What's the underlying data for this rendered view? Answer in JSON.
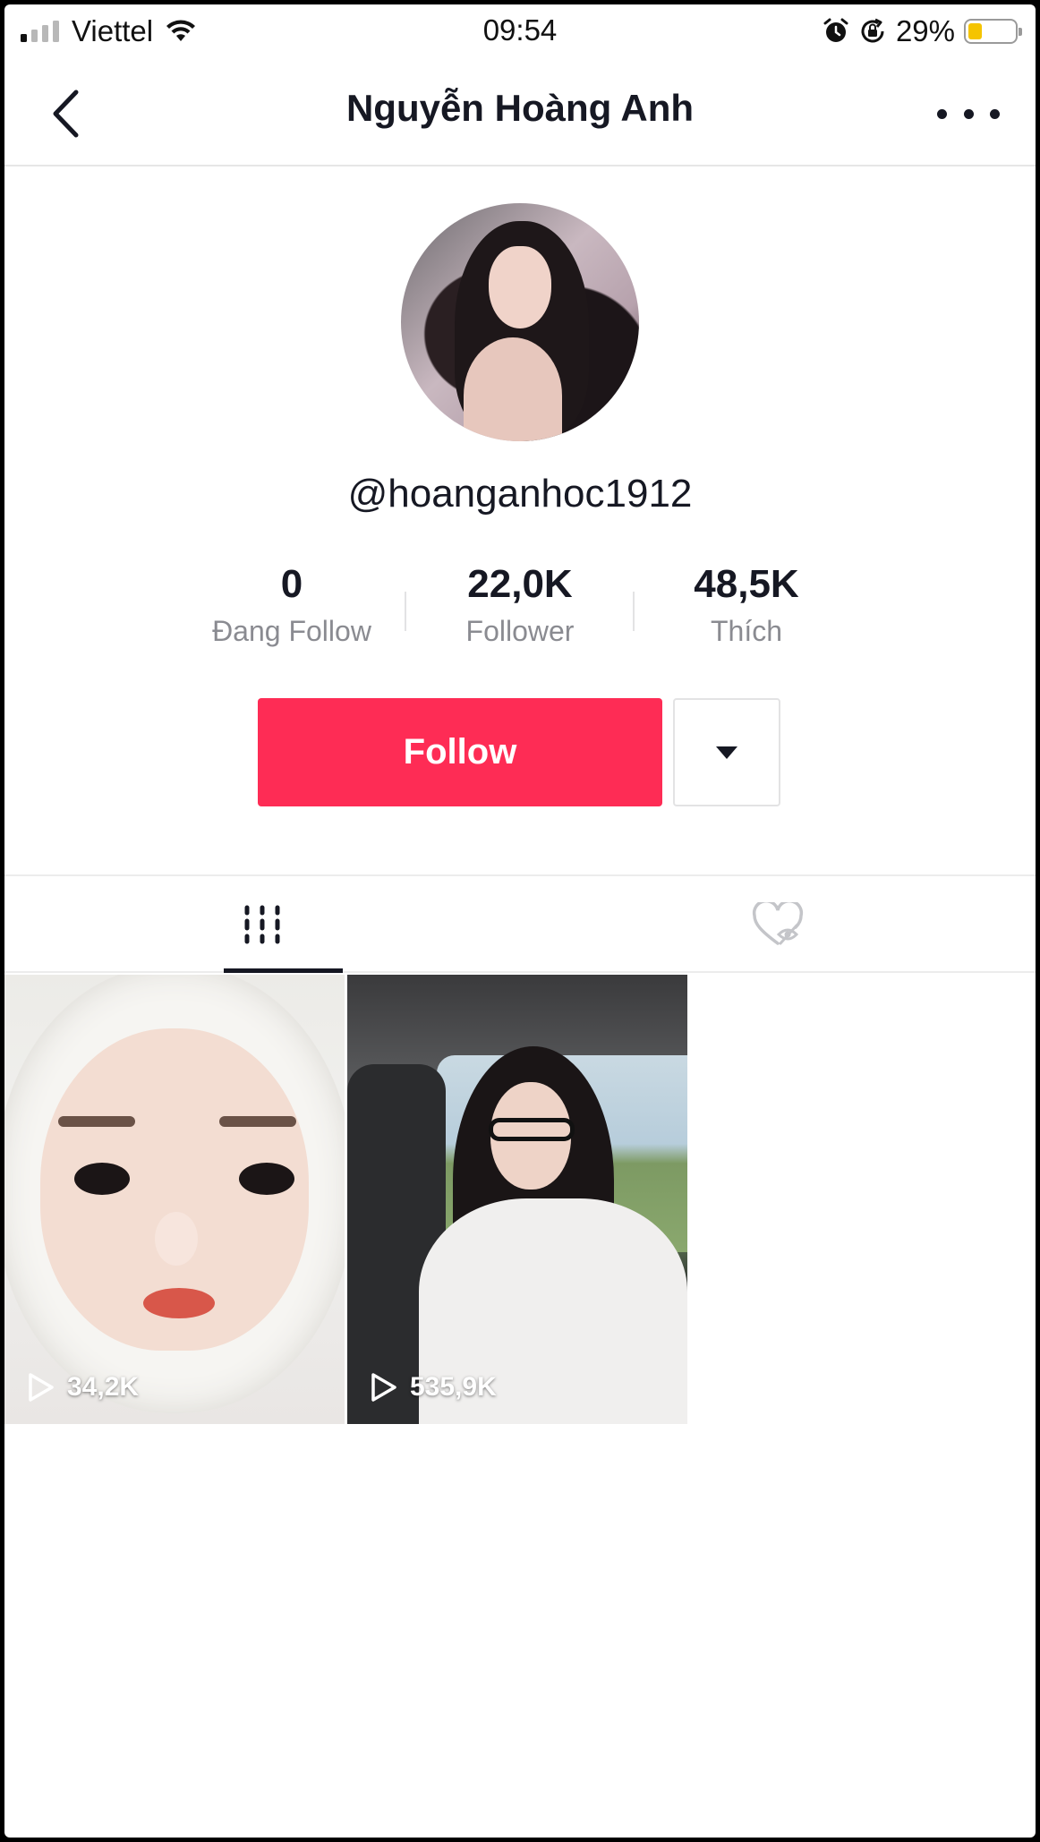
{
  "status_bar": {
    "carrier": "Viettel",
    "time": "09:54",
    "battery_percent": "29%",
    "battery_level": 0.29,
    "signal_icon": "cellular-signal-icon",
    "wifi_icon": "wifi-icon",
    "alarm_icon": "alarm-icon",
    "rotation_lock_icon": "rotation-lock-icon"
  },
  "nav": {
    "title": "Nguyễn Hoàng Anh",
    "back_icon": "chevron-left-icon",
    "more_icon": "more-horizontal-icon"
  },
  "profile": {
    "username": "@hoanganhoc1912",
    "stats": [
      {
        "value": "0",
        "label": "Đang Follow"
      },
      {
        "value": "22,0K",
        "label": "Follower"
      },
      {
        "value": "48,5K",
        "label": "Thích"
      }
    ],
    "follow_label": "Follow",
    "dropdown_icon": "caret-down-icon"
  },
  "tabs": [
    {
      "name": "videos",
      "icon": "video-grid-icon",
      "active": true
    },
    {
      "name": "liked",
      "icon": "heart-hidden-icon",
      "active": false
    }
  ],
  "videos": [
    {
      "views": "34,2K",
      "icon": "play-icon"
    },
    {
      "views": "535,9K",
      "icon": "play-icon"
    }
  ],
  "colors": {
    "accent": "#fe2c55",
    "text_primary": "#161823",
    "text_secondary": "#8a8b91",
    "battery": "#f5c400"
  }
}
